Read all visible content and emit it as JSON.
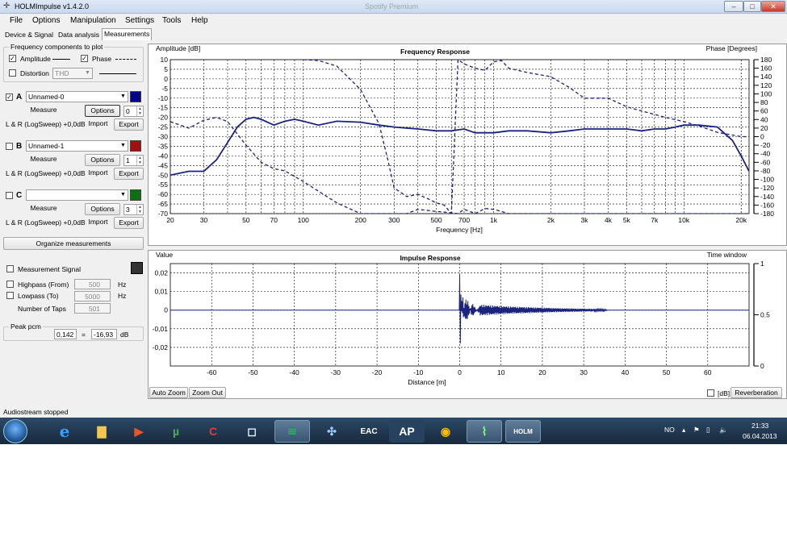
{
  "window": {
    "title": "HOLMImpulse  v1.4.2.0",
    "bg_title": "Spotify Premium"
  },
  "menu": [
    "File",
    "Options",
    "Manipulation",
    "Settings",
    "Tools",
    "Help"
  ],
  "tabs": [
    "Device & Signal",
    "Data analysis",
    "Measurements"
  ],
  "freq_components": {
    "title": "Frequency components to plot",
    "amplitude": "Amplitude",
    "phase": "Phase",
    "distortion": "Distortion",
    "distortion_select": "THD"
  },
  "measurements": [
    {
      "letter": "A",
      "name": "Unnamed-0",
      "checked": true,
      "measure": "Measure",
      "options": "Options",
      "value": "0",
      "info": "L & R (LogSweep) +0,0dB",
      "import": "Import",
      "export": "Export",
      "color": "#00008b"
    },
    {
      "letter": "B",
      "name": "Unnamed-1",
      "checked": false,
      "measure": "Measure",
      "options": "Options",
      "value": "1",
      "info": "L & R (LogSweep) +0,0dB",
      "import": "Import",
      "export": "Export",
      "color": "#a01010"
    },
    {
      "letter": "C",
      "name": "",
      "checked": false,
      "measure": "Measure",
      "options": "Options",
      "value": "3",
      "info": "L & R (LogSweep) +0,0dB",
      "import": "Import",
      "export": "Export",
      "color": "#107010"
    }
  ],
  "organize": "Organize measurements",
  "signal": {
    "title": "Measurement Signal",
    "highpass": "Highpass (From)",
    "highpass_val": "500",
    "hz1": "Hz",
    "lowpass": "Lowpass (To)",
    "lowpass_val": "5000",
    "hz2": "Hz",
    "taps": "Number of Taps",
    "taps_val": "501"
  },
  "peak": {
    "title": "Peak pcm",
    "value": "0,142",
    "eq": "=",
    "db_value": "-16,93",
    "unit": "dB"
  },
  "status": "Audiostream stopped",
  "taskbar": {
    "lang": "NO",
    "time": "21:33",
    "date": "06.04.2013"
  },
  "chart_data": [
    {
      "type": "line",
      "title": "Frequency Response",
      "ylabel": "Amplitude [dB]",
      "y2label": "Phase [Degrees]",
      "xlabel": "Frequency [Hz]",
      "xscale": "log",
      "xlim": [
        20,
        22000
      ],
      "ylim": [
        -70,
        10
      ],
      "y2lim": [
        -180,
        180
      ],
      "x_ticks": [
        "20",
        "30",
        "50",
        "70",
        "100",
        "200",
        "300",
        "500",
        "700",
        "1k",
        "2k",
        "3k",
        "4k",
        "5k",
        "7k",
        "10k",
        "20k"
      ],
      "y_ticks": [
        "10",
        "5",
        "0",
        "-5",
        "-10",
        "-15",
        "-20",
        "-25",
        "-30",
        "-35",
        "-40",
        "-45",
        "-50",
        "-55",
        "-60",
        "-65",
        "-70"
      ],
      "y2_ticks": [
        "180",
        "160",
        "140",
        "120",
        "100",
        "80",
        "60",
        "40",
        "20",
        "0",
        "-20",
        "-40",
        "-60",
        "-80",
        "-100",
        "-120",
        "-140",
        "-160",
        "-180"
      ],
      "grid": true,
      "series": [
        {
          "style": "solid",
          "color": "#1a237e",
          "x": [
            20,
            25,
            30,
            35,
            40,
            45,
            50,
            55,
            60,
            70,
            80,
            90,
            100,
            120,
            150,
            200,
            250,
            300,
            400,
            500,
            600,
            700,
            800,
            1000,
            1200,
            1500,
            2000,
            2500,
            3000,
            4000,
            5000,
            6000,
            7000,
            8000,
            9000,
            10000,
            12000,
            15000,
            18000,
            20000,
            22000
          ],
          "y": [
            -50,
            -48,
            -48,
            -42,
            -33,
            -25,
            -21,
            -20,
            -21,
            -24,
            -22,
            -21,
            -22,
            -24,
            -22,
            -22.5,
            -24,
            -25,
            -26,
            -27,
            -27,
            -26,
            -28,
            -28,
            -27,
            -27,
            -28,
            -27,
            -26,
            -26,
            -26,
            -27,
            -26,
            -26,
            -25,
            -24,
            -24,
            -25,
            -32,
            -40,
            -48
          ]
        },
        {
          "style": "dashed",
          "color": "#1a237e",
          "axis": "phase",
          "x": [
            20,
            25,
            30,
            35,
            40,
            50,
            60,
            70,
            80,
            100,
            150,
            200,
            250,
            280,
            300,
            350,
            400,
            500,
            600,
            650,
            700,
            750,
            800,
            900,
            1000,
            1100,
            1200,
            1300,
            1500,
            2000,
            2500,
            3000,
            4000,
            5000,
            6000,
            7000,
            8000,
            10000,
            12000,
            15000,
            20000,
            22000
          ],
          "y": [
            35,
            20,
            38,
            45,
            35,
            -20,
            -60,
            -75,
            -80,
            -105,
            -155,
            -180,
            -180,
            -180,
            -180,
            -180,
            -170,
            -175,
            -178,
            -180,
            -170,
            -175,
            -180,
            -168,
            -170,
            -175,
            -180,
            -180,
            -180,
            -180,
            -180,
            -180,
            -180,
            -180,
            -180,
            -180,
            -180,
            -180,
            -180,
            -180,
            -180,
            -180
          ]
        },
        {
          "style": "dashed",
          "color": "#1a237e",
          "axis": "phase",
          "x": [
            100,
            120,
            150,
            200,
            250,
            280,
            300,
            350,
            400,
            450,
            500,
            550,
            600,
            650,
            700,
            800,
            900,
            1000,
            1100,
            1200,
            1500,
            2000,
            2500,
            3000,
            4000,
            5000,
            6000,
            7000,
            8000,
            10000,
            12000,
            15000,
            20000,
            22000
          ],
          "y": [
            180,
            178,
            165,
            110,
            30,
            -60,
            -120,
            -140,
            -135,
            -145,
            -155,
            -160,
            -180,
            180,
            170,
            160,
            155,
            175,
            178,
            160,
            150,
            140,
            115,
            90,
            90,
            70,
            60,
            52,
            45,
            35,
            25,
            10,
            0,
            0
          ]
        }
      ]
    },
    {
      "type": "line",
      "title": "Impulse Response",
      "ylabel": "Value",
      "y2label": "Time window",
      "xlabel": "Distance [m]",
      "xlim": [
        -70,
        70
      ],
      "ylim": [
        -0.03,
        0.025
      ],
      "y2lim": [
        0,
        1
      ],
      "x_ticks": [
        "-60",
        "-50",
        "-40",
        "-30",
        "-20",
        "-10",
        "0",
        "10",
        "20",
        "30",
        "40",
        "50",
        "60"
      ],
      "y_ticks": [
        "0,02",
        "0,01",
        "0",
        "-0,01",
        "-0,02"
      ],
      "y2_ticks": [
        "1",
        "0.5",
        "0"
      ],
      "grid": true,
      "series": [
        {
          "style": "solid",
          "color": "#1a237e",
          "x": [
            -70,
            -0.1,
            0,
            0.2,
            0.5,
            0.8,
            1.2,
            2,
            3,
            5,
            8,
            12,
            18,
            25,
            30,
            35,
            36,
            70
          ],
          "y": [
            0,
            0,
            0.019,
            -0.018,
            0.008,
            -0.01,
            0.006,
            0.005,
            -0.004,
            0.003,
            0.0025,
            0.002,
            0.0015,
            0.001,
            0.0008,
            0.0005,
            0,
            0
          ]
        }
      ]
    }
  ],
  "plot_buttons": {
    "auto_zoom": "Auto Zoom",
    "zoom_out": "Zoom Out",
    "db": "[dB]",
    "reverberation": "Reverberation"
  }
}
